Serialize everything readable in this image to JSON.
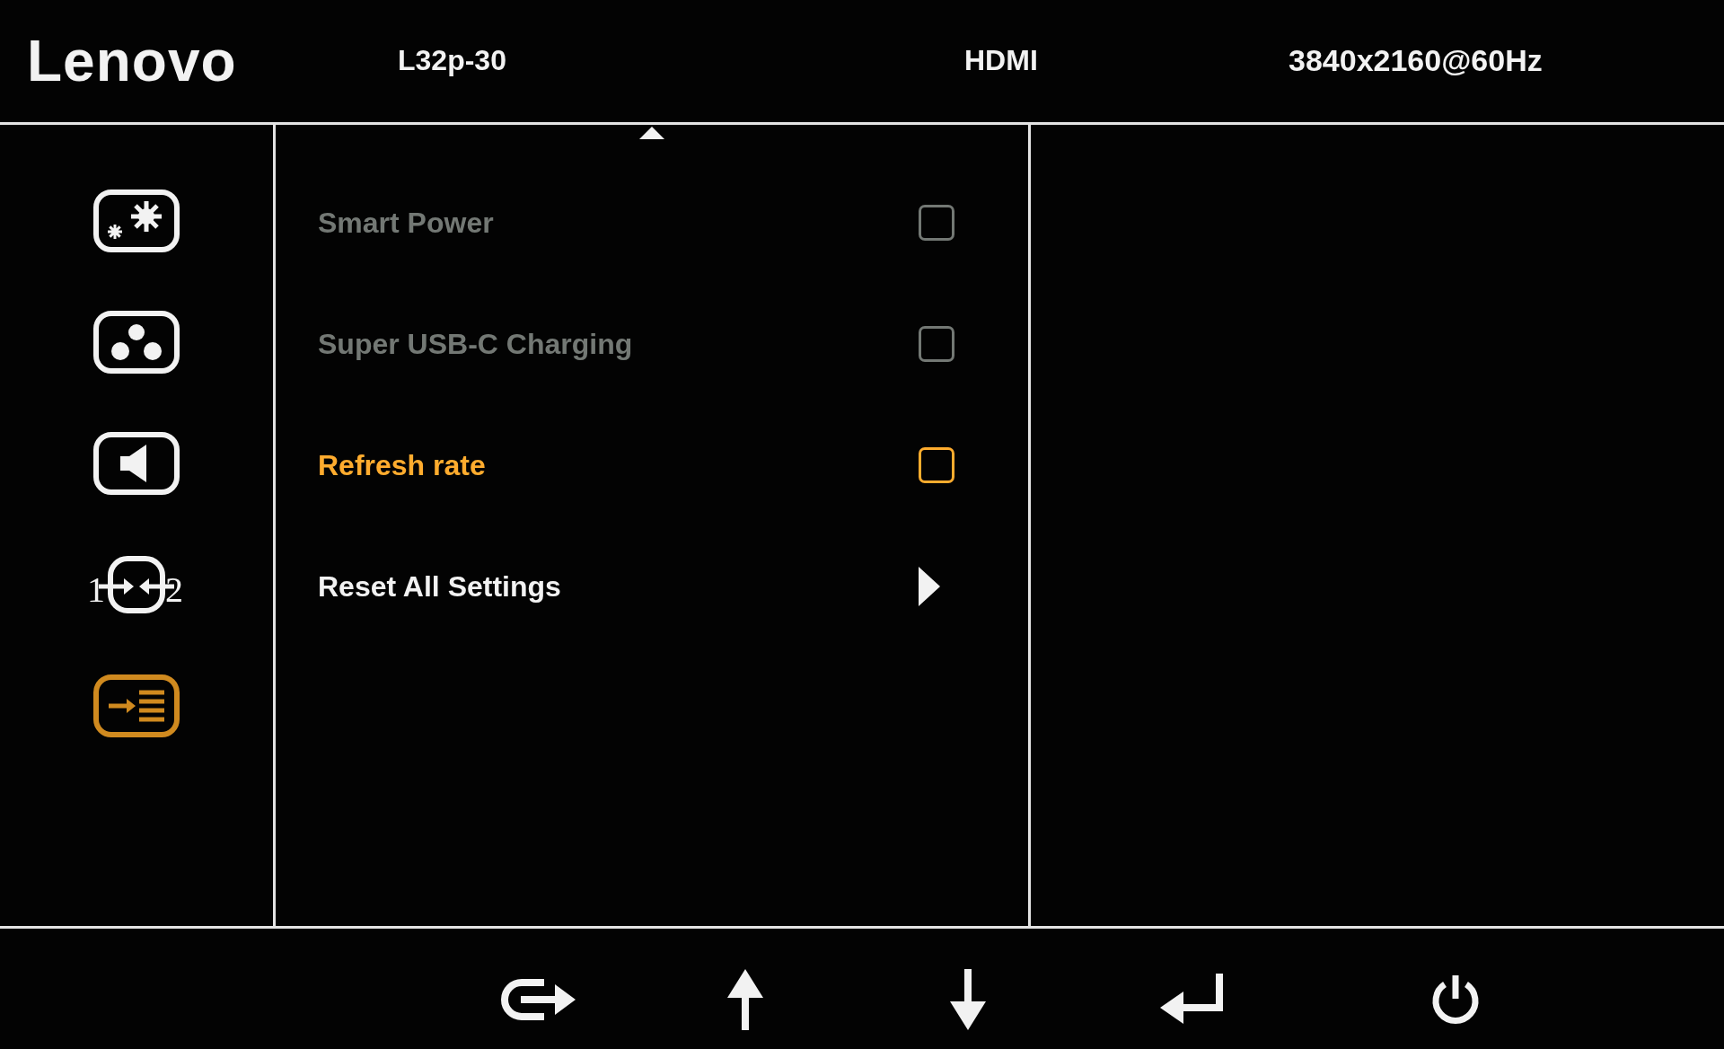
{
  "header": {
    "brand": "Lenovo",
    "model": "L32p-30",
    "input": "HDMI",
    "resolution": "3840x2160@60Hz"
  },
  "sidebar": {
    "items": [
      {
        "kind": "picture",
        "selected": false
      },
      {
        "kind": "color",
        "selected": false
      },
      {
        "kind": "audio",
        "selected": false
      },
      {
        "kind": "input",
        "selected": false,
        "labels": [
          "1",
          "2"
        ]
      },
      {
        "kind": "options",
        "selected": true
      }
    ]
  },
  "menu": {
    "items": [
      {
        "kind": "checkbox",
        "label": "Smart Power",
        "checked": false,
        "disabled": true,
        "selected": false
      },
      {
        "kind": "checkbox",
        "label": "Super USB-C Charging",
        "checked": false,
        "disabled": true,
        "selected": false
      },
      {
        "kind": "checkbox",
        "label": "Refresh rate",
        "checked": false,
        "disabled": false,
        "selected": true
      },
      {
        "kind": "submenu",
        "label": "Reset All Settings",
        "disabled": false,
        "selected": false
      }
    ]
  }
}
